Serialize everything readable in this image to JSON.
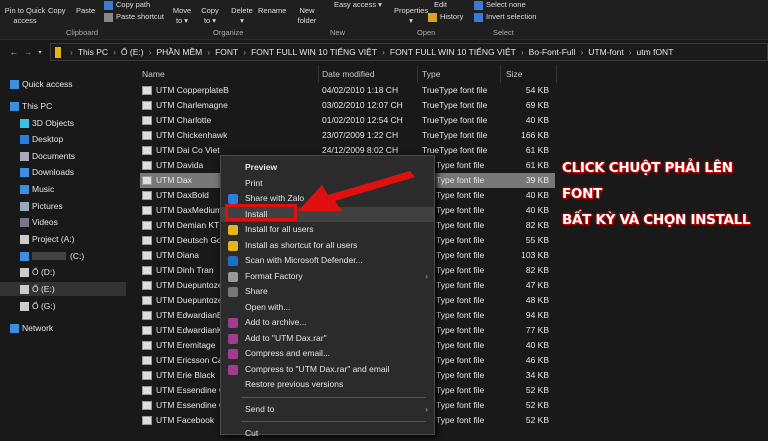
{
  "ribbon": {
    "buttons": [
      "Pin to Quick access",
      "Copy",
      "Paste",
      "Copy path",
      "Paste shortcut",
      "Move to ▾",
      "Copy to ▾",
      "Delete ▾",
      "Rename",
      "New folder",
      "Easy access ▾",
      "Properties ▾",
      "Edit",
      "History",
      "Select none",
      "Invert selection"
    ],
    "groups": [
      "Clipboard",
      "Organize",
      "New",
      "Open",
      "Select"
    ]
  },
  "address": {
    "crumbs": [
      "This PC",
      "Ổ (E:)",
      "PHẦN MỀM",
      "FONT",
      "FONT FULL WIN 10 TIẾNG VIỆT",
      "FONT FULL WIN 10 TIẾNG VIỆT",
      "Bo-Font-Full",
      "UTM-font",
      "utm fONT"
    ]
  },
  "sidebar": [
    "Quick access",
    "This PC",
    "3D Objects",
    "Desktop",
    "Documents",
    "Downloads",
    "Music",
    "Pictures",
    "Videos",
    "Project (A:)",
    "(C:)",
    "Ổ (D:)",
    "Ổ (E:)",
    "Ổ (G:)",
    "Network"
  ],
  "columns": [
    "Name",
    "Date modified",
    "Type",
    "Size"
  ],
  "files": [
    [
      "UTM CopperplateB",
      "04/02/2010 1:18 CH",
      "TrueType font file",
      "54 KB"
    ],
    [
      "UTM Charlemagne",
      "03/02/2010 12:07 CH",
      "TrueType font file",
      "69 KB"
    ],
    [
      "UTM Charlotte",
      "01/02/2010 12:54 CH",
      "TrueType font file",
      "40 KB"
    ],
    [
      "UTM Chickenhawk",
      "23/07/2009 1:22 CH",
      "TrueType font file",
      "166 KB"
    ],
    [
      "UTM Dai Co Viet",
      "24/12/2009 8:02 CH",
      "TrueType font file",
      "61 KB"
    ],
    [
      "UTM Davida",
      "",
      "Type font file",
      "61 KB"
    ],
    [
      "UTM Dax",
      "",
      "Type font file",
      "39 KB"
    ],
    [
      "UTM DaxBold",
      "",
      "Type font file",
      "40 KB"
    ],
    [
      "UTM DaxMedium",
      "",
      "Type font file",
      "40 KB"
    ],
    [
      "UTM Demian KT",
      "",
      "Type font file",
      "82 KB"
    ],
    [
      "UTM Deutsch Got",
      "",
      "Type font file",
      "55 KB"
    ],
    [
      "UTM Diana",
      "",
      "Type font file",
      "103 KB"
    ],
    [
      "UTM Dinh Tran",
      "",
      "Type font file",
      "82 KB"
    ],
    [
      "UTM Duepuntoze",
      "",
      "Type font file",
      "47 KB"
    ],
    [
      "UTM Duepuntoze",
      "",
      "Type font file",
      "48 KB"
    ],
    [
      "UTM EdwardianB",
      "",
      "Type font file",
      "94 KB"
    ],
    [
      "UTM EdwardianK",
      "",
      "Type font file",
      "77 KB"
    ],
    [
      "UTM Eremitage",
      "",
      "Type font file",
      "40 KB"
    ],
    [
      "UTM Ericsson Cap",
      "",
      "Type font file",
      "46 KB"
    ],
    [
      "UTM Erie Black",
      "",
      "Type font file",
      "34 KB"
    ],
    [
      "UTM Essendine C",
      "",
      "Type font file",
      "52 KB"
    ],
    [
      "UTM Essendine C",
      "",
      "Type font file",
      "52 KB"
    ],
    [
      "UTM Facebook",
      "",
      "Type font file",
      "52 KB"
    ]
  ],
  "menu": [
    {
      "label": "Preview",
      "bold": true
    },
    {
      "label": "Print"
    },
    {
      "label": "Share with Zalo",
      "icon": "zalo-icon",
      "color": "#2a7de1"
    },
    {
      "label": "Install",
      "hl": true
    },
    {
      "label": "Install for all users",
      "icon": "shield-icon",
      "color": "#e8b21c"
    },
    {
      "label": "Install as shortcut for all users",
      "icon": "shield-icon",
      "color": "#e8b21c"
    },
    {
      "label": "Scan with Microsoft Defender...",
      "icon": "defender-icon",
      "color": "#1f6fc4"
    },
    {
      "label": "Format Factory",
      "icon": "format-factory-icon",
      "color": "#999",
      "sub": true
    },
    {
      "label": "Share",
      "icon": "share-icon",
      "color": "#777"
    },
    {
      "label": "Open with..."
    },
    {
      "label": "Add to archive...",
      "icon": "winrar-icon",
      "color": "#a03c8c"
    },
    {
      "label": "Add to \"UTM Dax.rar\"",
      "icon": "winrar-icon",
      "color": "#a03c8c"
    },
    {
      "label": "Compress and email...",
      "icon": "winrar-icon",
      "color": "#a03c8c"
    },
    {
      "label": "Compress to \"UTM Dax.rar\" and email",
      "icon": "winrar-icon",
      "color": "#a03c8c"
    },
    {
      "label": "Restore previous versions"
    },
    {
      "sep": true
    },
    {
      "label": "Send to",
      "sub": true
    },
    {
      "sep": true
    },
    {
      "label": "Cut"
    }
  ],
  "annotation": {
    "line1": "CLICK CHUỘT PHẢI LÊN FONT",
    "line2": "BẤT KỲ VÀ CHỌN INSTALL"
  }
}
